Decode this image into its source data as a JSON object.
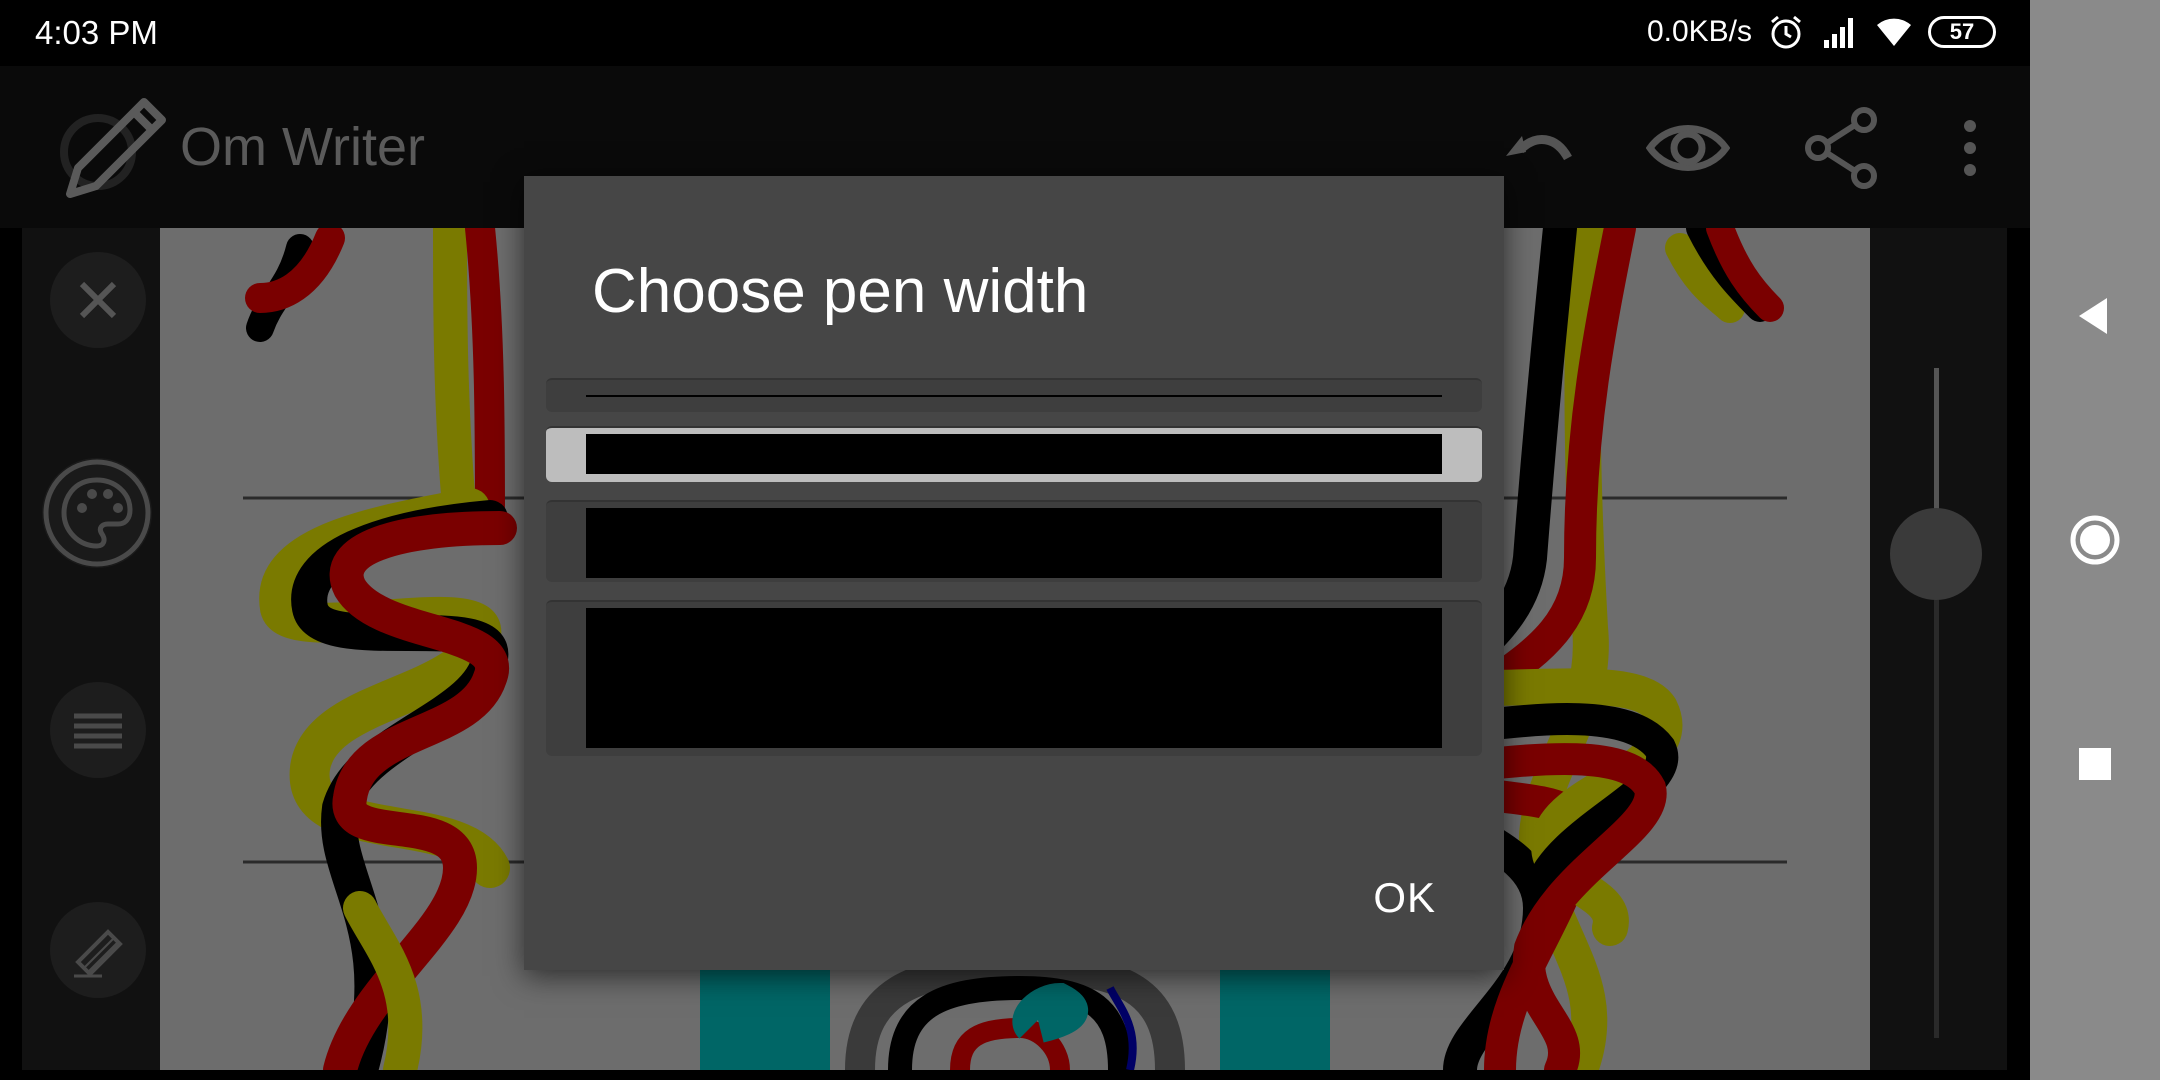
{
  "status_bar": {
    "time": "4:03 PM",
    "net_speed": "0.0KB/s",
    "battery": "57",
    "icons": [
      "alarm-icon",
      "signal-icon",
      "wifi-icon"
    ]
  },
  "app_bar": {
    "title": "Om Writer",
    "actions": [
      "undo-icon",
      "eye-icon",
      "share-icon",
      "more-vert-icon"
    ]
  },
  "left_toolbar": {
    "tools": [
      "close-icon",
      "palette-icon",
      "menu-lines-icon",
      "eraser-icon"
    ]
  },
  "dialog": {
    "title": "Choose pen width",
    "options": [
      {
        "width": "thinnest",
        "selected": false
      },
      {
        "width": "thin",
        "selected": true
      },
      {
        "width": "medium",
        "selected": false
      },
      {
        "width": "thick",
        "selected": false
      }
    ],
    "ok_label": "OK"
  },
  "nav_bar": {
    "buttons": [
      "back-icon",
      "home-icon",
      "recents-icon"
    ]
  },
  "colors": {
    "stroke_red": "#7a0000",
    "stroke_yellow": "#7a7a00",
    "stroke_black": "#000000",
    "stroke_teal": "#006666",
    "dialog_bg": "#464646",
    "canvas_bg": "#6d6d6d"
  }
}
